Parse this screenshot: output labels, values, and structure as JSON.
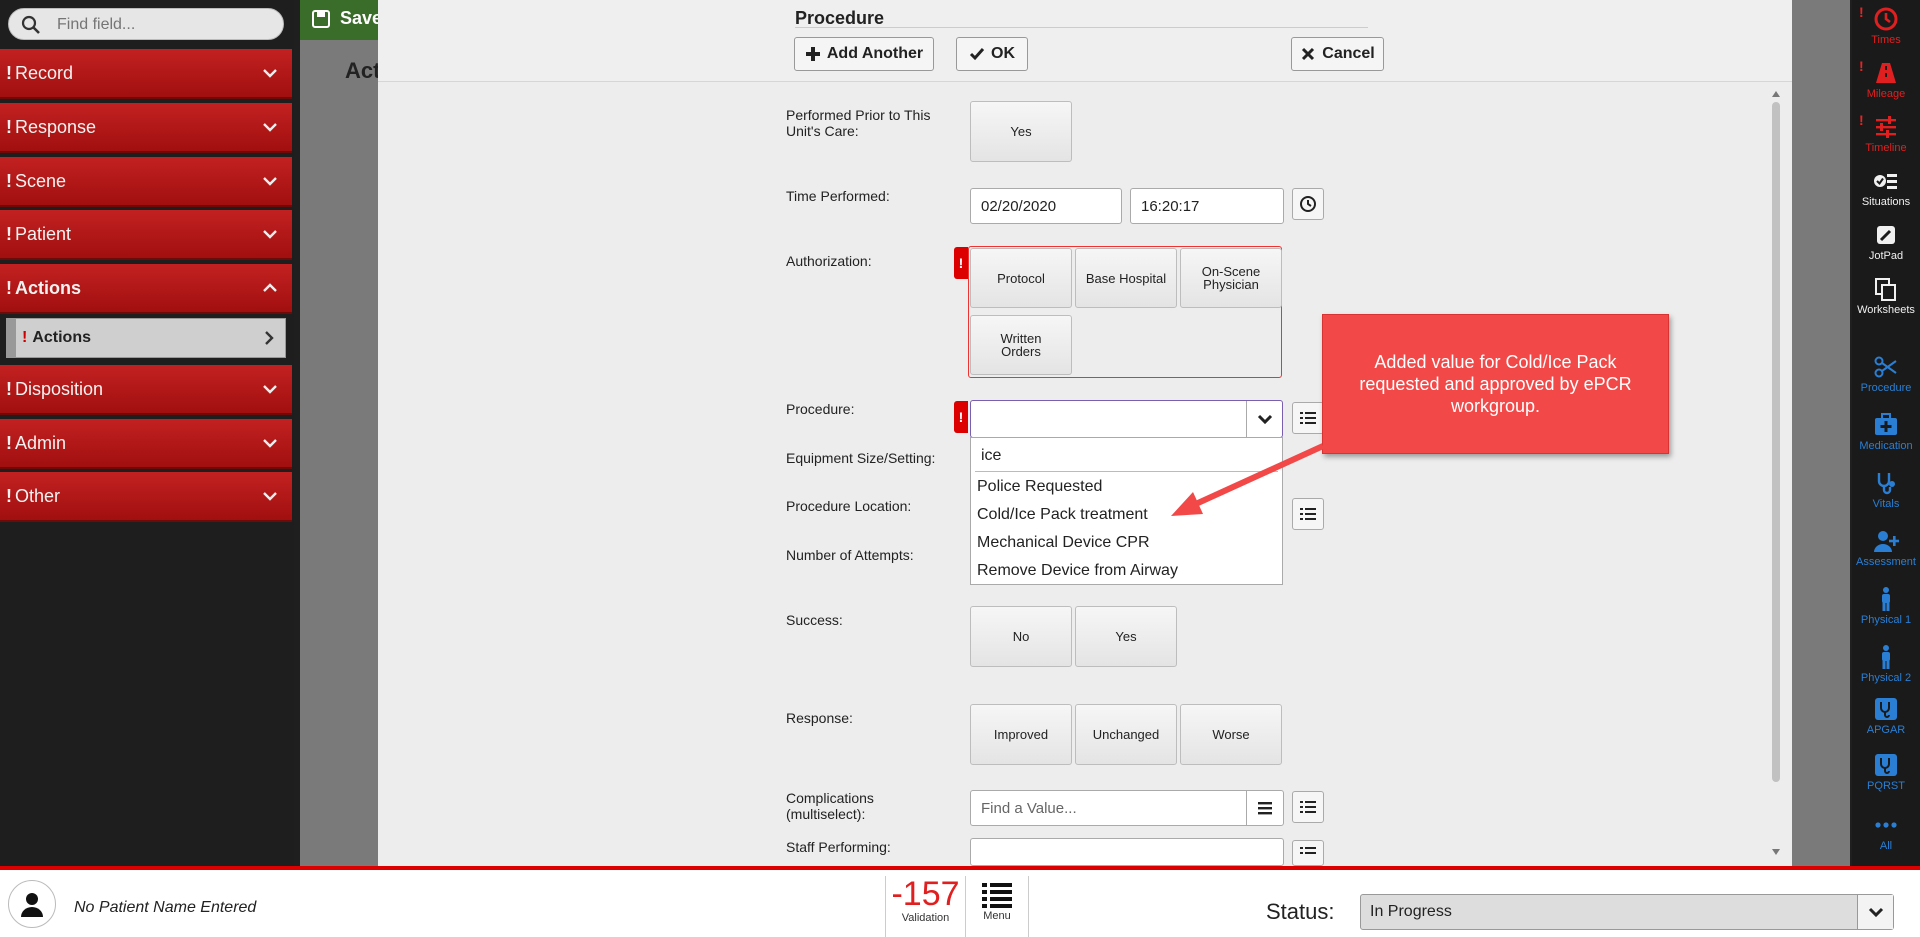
{
  "sidebar": {
    "search_placeholder": "Find field...",
    "items": [
      {
        "label": "Record"
      },
      {
        "label": "Response"
      },
      {
        "label": "Scene"
      },
      {
        "label": "Patient"
      },
      {
        "label": "Actions"
      },
      {
        "label": "Disposition"
      },
      {
        "label": "Admin"
      },
      {
        "label": "Other"
      }
    ],
    "sub_item": "Actions",
    "alert_mark": "!"
  },
  "background": {
    "save_label": "Save",
    "section_title": "Acti"
  },
  "modal": {
    "title": "Procedure",
    "add_another_label": "Add Another",
    "ok_label": "OK",
    "cancel_label": "Cancel"
  },
  "form": {
    "performed_prior": {
      "label": "Performed Prior to This Unit's Care:",
      "option_yes": "Yes"
    },
    "time_performed": {
      "label": "Time Performed:",
      "date": "02/20/2020",
      "time": "16:20:17"
    },
    "authorization": {
      "label": "Authorization:",
      "options": [
        "Protocol",
        "Base Hospital",
        "On-Scene Physician",
        "Written Orders"
      ]
    },
    "procedure": {
      "label": "Procedure:",
      "search_text": "ice",
      "options": [
        "Police Requested",
        "Cold/Ice Pack treatment",
        "Mechanical Device CPR",
        "Remove Device from Airway"
      ]
    },
    "equipment_label": "Equipment Size/Setting:",
    "location_label": "Procedure Location:",
    "attempts_label": "Number of Attempts:",
    "success": {
      "label": "Success:",
      "options": [
        "No",
        "Yes"
      ]
    },
    "response": {
      "label": "Response:",
      "options": [
        "Improved",
        "Unchanged",
        "Worse"
      ]
    },
    "complications": {
      "label": "Complications (multiselect):",
      "placeholder": "Find a Value..."
    },
    "staff_label": "Staff Performing:"
  },
  "callout": {
    "text": "Added value for Cold/Ice Pack requested and approved by ePCR workgroup."
  },
  "rightbar": {
    "items": [
      {
        "label": "Times",
        "icon": "clock-icon",
        "alert": true
      },
      {
        "label": "Mileage",
        "icon": "road-icon",
        "alert": true
      },
      {
        "label": "Timeline",
        "icon": "sliders-icon",
        "alert": true
      },
      {
        "label": "Situations",
        "icon": "checklist-icon",
        "alert": false
      },
      {
        "label": "JotPad",
        "icon": "pencil-icon",
        "alert": false
      },
      {
        "label": "Worksheets",
        "icon": "copy-icon",
        "alert": false
      },
      {
        "label": "Procedure",
        "icon": "scissors-icon",
        "alert": false
      },
      {
        "label": "Medication",
        "icon": "medkit-icon",
        "alert": false
      },
      {
        "label": "Vitals",
        "icon": "stethoscope-icon",
        "alert": false
      },
      {
        "label": "Assessment",
        "icon": "user-plus-icon",
        "alert": false
      },
      {
        "label": "Physical 1",
        "icon": "person-icon",
        "alert": false
      },
      {
        "label": "Physical 2",
        "icon": "person-icon",
        "alert": false
      },
      {
        "label": "APGAR",
        "icon": "stethoscope-box-icon",
        "alert": false
      },
      {
        "label": "PQRST",
        "icon": "stethoscope-box-icon",
        "alert": false
      },
      {
        "label": "All",
        "icon": "ellipsis-icon",
        "alert": false
      }
    ]
  },
  "bottombar": {
    "patient_name": "No Patient Name Entered",
    "validation_count": "-157",
    "validation_label": "Validation",
    "menu_label": "Menu",
    "status_label": "Status:",
    "status_value": "In Progress"
  },
  "colors": {
    "sidebar_red": "#b71818",
    "required_red": "#dd0000",
    "callout_red": "#f24848",
    "validation_red": "#e02020",
    "icon_blue": "#2a7fd4"
  }
}
